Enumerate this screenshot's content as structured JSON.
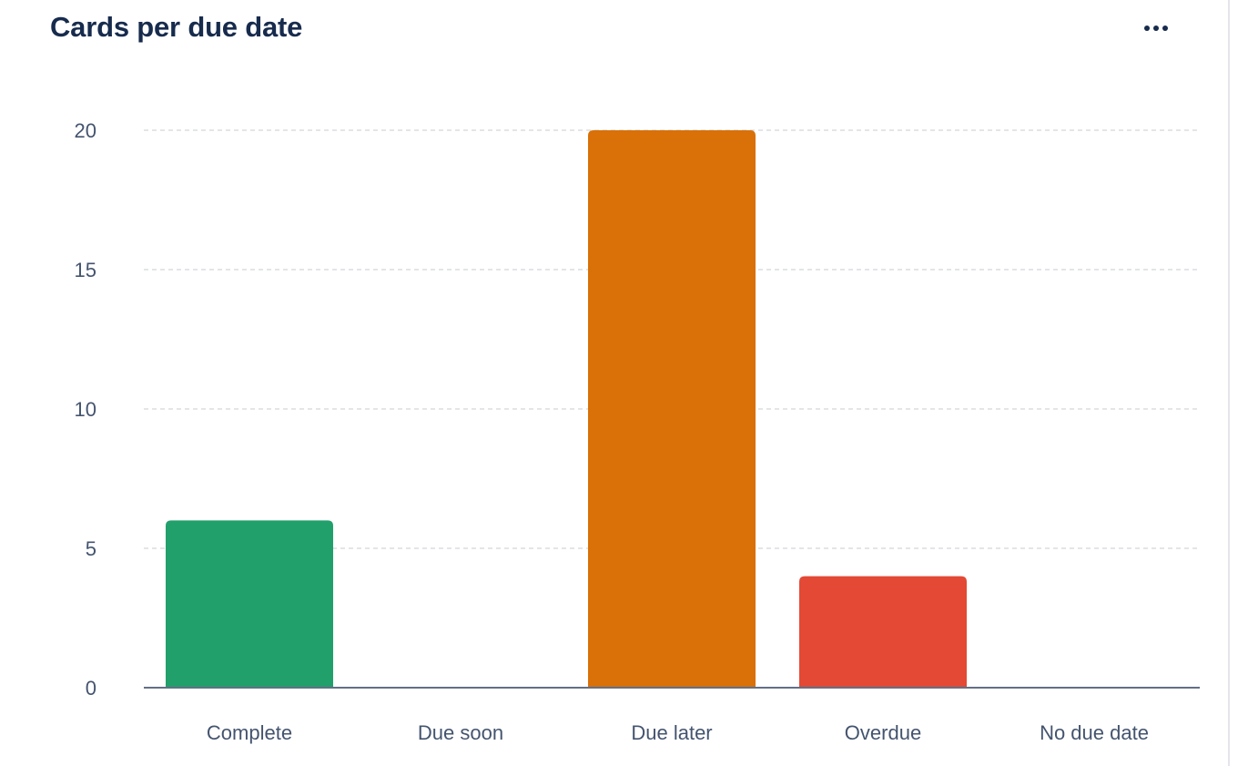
{
  "header": {
    "title": "Cards per due date",
    "menu_icon": "more-horizontal-icon"
  },
  "chart_data": {
    "type": "bar",
    "title": "Cards per due date",
    "xlabel": "",
    "ylabel": "",
    "categories": [
      "Complete",
      "Due soon",
      "Due later",
      "Overdue",
      "No due date"
    ],
    "values": [
      6,
      0,
      20,
      4,
      0
    ],
    "colors": [
      "#22a06b",
      "#f5cd47",
      "#d97008",
      "#e34935",
      "#8590a2"
    ],
    "ylim": [
      0,
      20
    ],
    "yticks": [
      0,
      5,
      10,
      15,
      20
    ],
    "grid": true,
    "legend": "none"
  }
}
